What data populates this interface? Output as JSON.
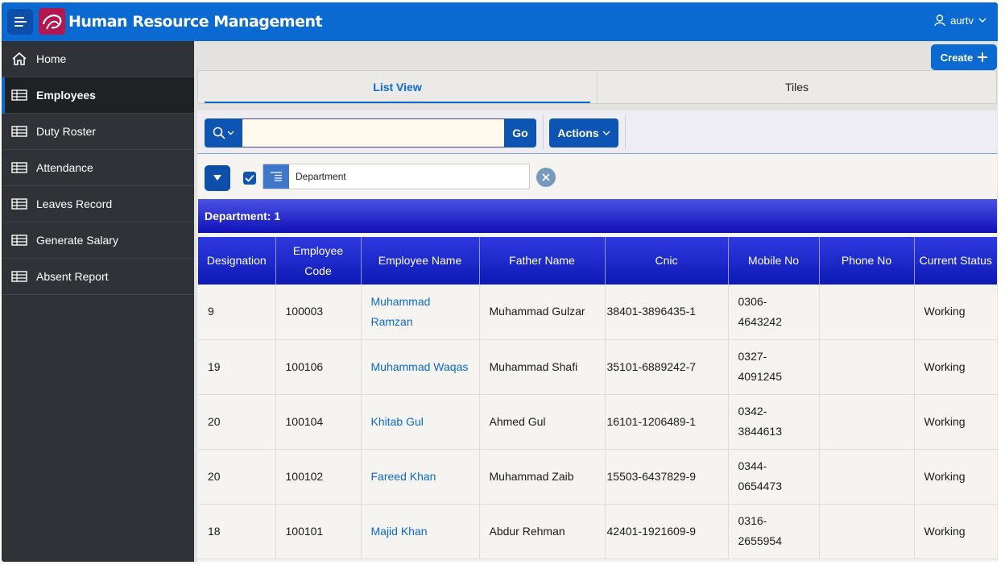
{
  "header": {
    "app_title": "Human Resource Management",
    "user_name": "aurtv"
  },
  "sidebar": {
    "items": [
      {
        "label": "Home",
        "icon": "home-icon"
      },
      {
        "label": "Employees",
        "icon": "table-icon",
        "active": true
      },
      {
        "label": "Duty Roster",
        "icon": "table-icon"
      },
      {
        "label": "Attendance",
        "icon": "table-icon"
      },
      {
        "label": "Leaves Record",
        "icon": "table-icon"
      },
      {
        "label": "Generate Salary",
        "icon": "table-icon"
      },
      {
        "label": "Absent Report",
        "icon": "table-icon"
      }
    ]
  },
  "create_label": "Create",
  "tabs": [
    {
      "label": "List View",
      "active": true
    },
    {
      "label": "Tiles"
    }
  ],
  "toolbar": {
    "search_value": "",
    "go_label": "Go",
    "actions_label": "Actions"
  },
  "filter": {
    "label": "Department"
  },
  "group": {
    "label": "Department: 1"
  },
  "table": {
    "columns": [
      "Designation",
      "Employee Code",
      "Employee Name",
      "Father Name",
      "Cnic",
      "Mobile No",
      "Phone No",
      "Current Status"
    ],
    "rows": [
      [
        "9",
        "100003",
        "Muhammad Ramzan",
        "Muhammad Gulzar",
        "38401-3896435-1",
        "0306-4643242",
        "",
        "Working"
      ],
      [
        "19",
        "100106",
        "Muhammad Waqas",
        "Muhammad Shafi",
        "35101-6889242-7",
        "0327-4091245",
        "",
        "Working"
      ],
      [
        "20",
        "100104",
        "Khitab Gul",
        "Ahmed Gul",
        "16101-1206489-1",
        "0342-3844613",
        "",
        "Working"
      ],
      [
        "20",
        "100102",
        "Fareed Khan",
        "Muhammad Zaib",
        "15503-6437829-9",
        "0344-0654473",
        "",
        "Working"
      ],
      [
        "18",
        "100101",
        "Majid Khan",
        "Abdur Rehman",
        "42401-1921609-9",
        "0316-2655954",
        "",
        "Working"
      ]
    ]
  },
  "colors": {
    "brand": "#0a6ad2",
    "sidebar": "#2f3337",
    "header_gradient_top": "#2e3ae0",
    "header_gradient_bottom": "#0e1ab4",
    "link": "#0a6ad2"
  }
}
